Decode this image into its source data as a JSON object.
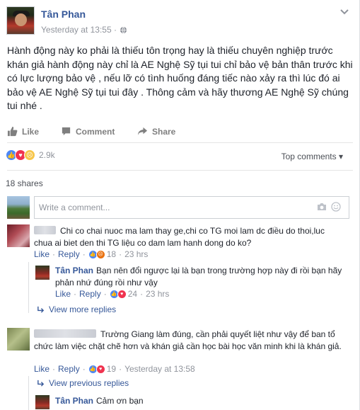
{
  "post": {
    "author": "Tân Phan",
    "timestamp": "Yesterday at 13:55 ·",
    "text": "Hành động này ko phải là thiếu tôn trọng hay là thiếu chuyên nghiệp trước khán giả hành động này chỉ là AE Nghệ Sỹ tụi tui chỉ bảo vệ bản thân trước khi có lực lượng bảo vệ , nếu lỡ có tình huống đáng tiếc nào xảy ra thì lúc đó ai bảo vệ AE Nghệ Sỹ tụi tui đây . Thông cảm và hãy thương AE Nghệ Sỹ chúng tui nhé ."
  },
  "actions": {
    "like": "Like",
    "comment": "Comment",
    "share": "Share"
  },
  "reactions": {
    "count": "2.9k",
    "top_comments": "Top comments ▾"
  },
  "shares": "18 shares",
  "composer": {
    "placeholder": "Write a comment..."
  },
  "comments": [
    {
      "text": "Chi co chai nuoc ma lam thay ge,chi co TG moi lam dc điều do thoi,luc chua ai biet den thi TG liệu co dam lam hanh dong do ko?",
      "like": "Like",
      "reply": "Reply",
      "count": "18",
      "time": "23 hrs",
      "replies": [
        {
          "author": "Tân Phan",
          "text": "Bạn nên đổi ngược lại là bạn trong trường hợp này đi rồi bạn hãy phản nhứ đúng rồi như vậy",
          "like": "Like",
          "reply": "Reply",
          "count": "24",
          "time": "23 hrs"
        }
      ],
      "more_replies": "View more replies"
    },
    {
      "text": "Trường Giang làm đúng, cần phải quyết liệt như vậy để ban tổ chức làm việc chặt chẽ hơn và khán giả cần học bài học văn minh khi là khán giả.",
      "like": "Like",
      "reply": "Reply",
      "count": "19",
      "time": "Yesterday at 13:58",
      "prev_replies": "View previous replies",
      "replies": [
        {
          "author": "Tân Phan",
          "text": "Cảm ơn bạn"
        }
      ]
    }
  ],
  "colors": {
    "link": "#365899",
    "meta": "#90949c",
    "like": "#4d87f5",
    "love": "#f0334f"
  },
  "icons": [
    "globe-icon",
    "chevron-down-icon",
    "like-icon",
    "comment-icon",
    "share-icon",
    "camera-icon",
    "smiley-icon",
    "reply-arrow-icon"
  ]
}
